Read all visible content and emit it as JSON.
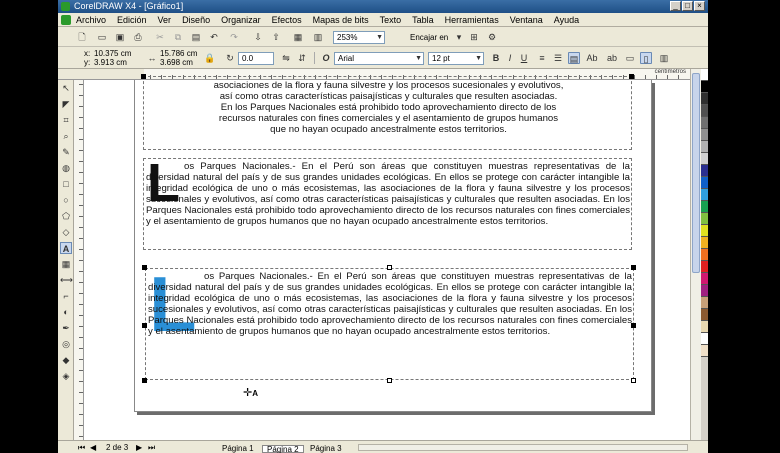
{
  "window": {
    "title": "CorelDRAW X4 - [Gráfico1]"
  },
  "menu": [
    "Archivo",
    "Edición",
    "Ver",
    "Diseño",
    "Organizar",
    "Efectos",
    "Mapas de bits",
    "Texto",
    "Tabla",
    "Herramientas",
    "Ventana",
    "Ayuda"
  ],
  "toolbar": {
    "zoom_value": "253%",
    "fit_label": "Encajar en",
    "x_value": "10.375 cm",
    "y_value": "3.913 cm",
    "width_value": "15.786 cm",
    "height_value": "3.698 cm",
    "rotation_value": "0.0",
    "font_name": "Arial",
    "font_size": "12 pt",
    "ruler_units": "centímetros"
  },
  "document": {
    "block1_lines": [
      "asociaciones de la flora y fauna silvestre y los procesos sucesionales y evolutivos,",
      "así como otras características paisajísticas y culturales que resulten asociadas.",
      "En los Parques Nacionales está prohibido todo aprovechamiento directo de los",
      "recursos naturales con fines comerciales y el asentamiento de grupos humanos",
      "que no hayan ocupado ancestralmente estos territorios."
    ],
    "block2_dropcap": "L",
    "block2_text": "os Parques Nacionales.- En el Perú son áreas que constituyen muestras representativas de la diversidad natural del país y de sus grandes unidades ecológicas. En ellos se protege con carácter intangible la integridad ecológica de uno o más ecosistemas, las asociaciones de la flora y fauna silvestre y los procesos sucesionales y evolutivos, así como otras características paisajísticas y culturales que resulten asociadas. En los Parques Nacionales está prohibido todo aprovechamiento directo de los recursos naturales con fines comerciales y el asentamiento de grupos humanos que no hayan ocupado ancestralmente estos territorios.",
    "block3_dropcap": "L",
    "block3_text": "os Parques Nacionales.- En el Perú son áreas que constituyen muestras representativas de la diversidad natural del país y de sus grandes unidades ecológicas. En ellos se protege con carácter intangible la integridad ecológica de uno o más ecosistemas, las asociaciones de la flora y fauna silvestre y los procesos sucesionales y evolutivos, así como otras características paisajísticas y culturales que resulten asociadas. En los Parques Nacionales está prohibido todo aprovechamiento directo de los recursos naturales con fines comerciales y el asentamiento de grupos humanos que no hayan ocupado ancestralmente estos territorios.",
    "block3_dropcap_color": "#2a8fd6"
  },
  "pager": {
    "page_count": "2 de 3",
    "tabs": [
      "Página 1",
      "Página 2",
      "Página 3"
    ],
    "active_tab": "Página 2"
  },
  "palette": [
    "#ffffff",
    "#000000",
    "#303030",
    "#505050",
    "#707070",
    "#909090",
    "#b0b0b0",
    "#d0d0d0",
    "#2b2f8f",
    "#1060c8",
    "#2fa0e0",
    "#18a050",
    "#80c040",
    "#e0e020",
    "#f0b020",
    "#f07020",
    "#e02020",
    "#d01870",
    "#a02080",
    "#c8a078",
    "#8c5a30",
    "#e8d8b0",
    "#ffffff",
    "#f0e0c8"
  ]
}
